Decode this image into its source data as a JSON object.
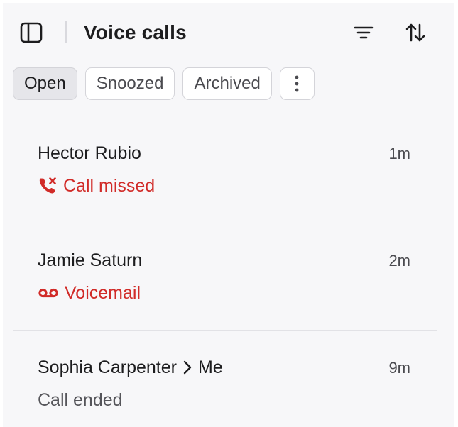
{
  "header": {
    "title": "Voice calls",
    "icons": [
      "sidebar-toggle-icon",
      "filter-icon",
      "sort-icon"
    ]
  },
  "tabs": [
    {
      "label": "Open",
      "active": true
    },
    {
      "label": "Snoozed",
      "active": false
    },
    {
      "label": "Archived",
      "active": false
    }
  ],
  "calls": [
    {
      "name": "Hector Rubio",
      "time": "1m",
      "status": "Call missed",
      "status_type": "missed",
      "status_icon": "phone-missed-icon"
    },
    {
      "name": "Jamie Saturn",
      "time": "2m",
      "status": "Voicemail",
      "status_type": "voicemail",
      "status_icon": "voicemail-icon"
    },
    {
      "name": "Sophia Carpenter",
      "recipient": "Me",
      "time": "9m",
      "status": "Call ended",
      "status_type": "ended"
    }
  ],
  "colors": {
    "panel_bg": "#f7f7f9",
    "text_primary": "#1d1d1f",
    "alert_red": "#d12b28",
    "tab_active_bg": "#e6e6ea",
    "border": "#d4d4d9"
  }
}
